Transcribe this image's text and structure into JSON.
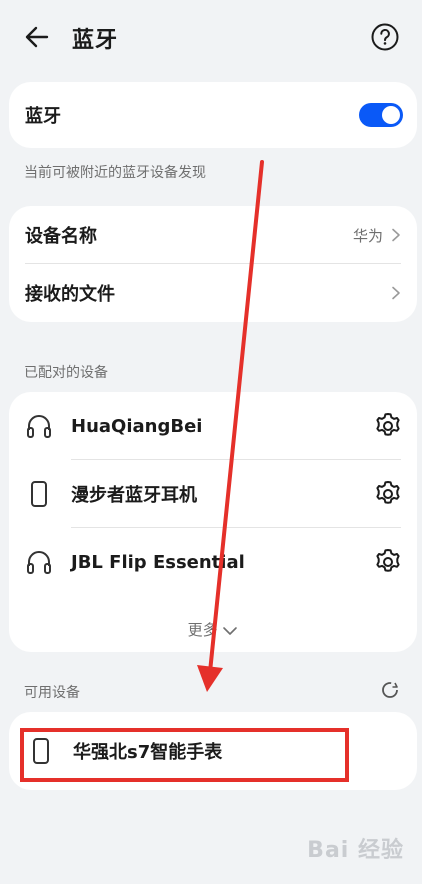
{
  "header": {
    "title": "蓝牙"
  },
  "bluetooth": {
    "label": "蓝牙",
    "enabled": true
  },
  "discover_hint": "当前可被附近的蓝牙设备发现",
  "settings": {
    "device_name_label": "设备名称",
    "device_name_value": "华为",
    "received_files_label": "接收的文件"
  },
  "paired": {
    "section_label": "已配对的设备",
    "devices": [
      {
        "name": "HuaQiangBei",
        "icon": "headphones-icon"
      },
      {
        "name": "漫步者蓝牙耳机",
        "icon": "phone-icon"
      },
      {
        "name": "JBL Flip Essential",
        "icon": "headphones-icon"
      }
    ],
    "more_label": "更多"
  },
  "available": {
    "section_label": "可用设备",
    "devices": [
      {
        "name": "华强北s7智能手表",
        "icon": "phone-icon"
      }
    ]
  },
  "colors": {
    "accent": "#0a59f7",
    "annotation": "#e5302a"
  },
  "watermark": "Bai 经验"
}
